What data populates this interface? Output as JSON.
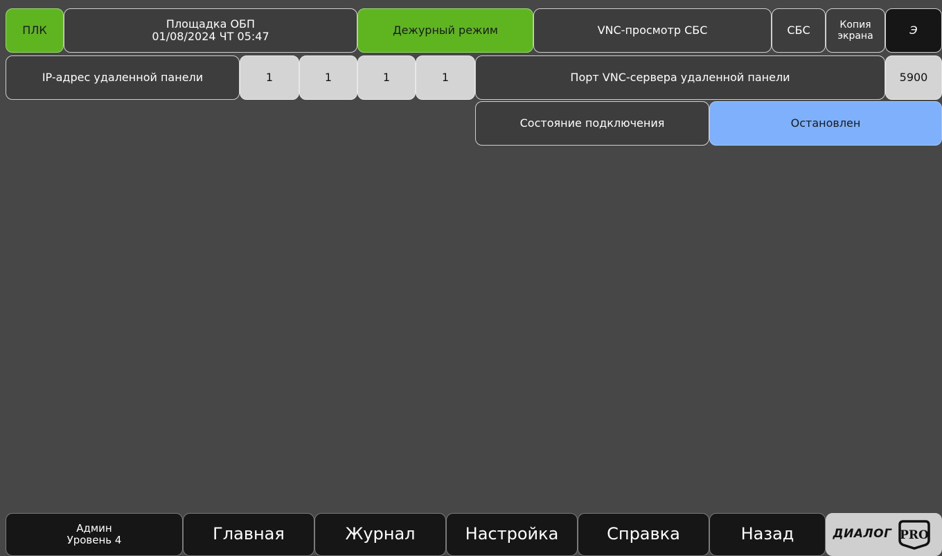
{
  "header": {
    "plc_label": "ПЛК",
    "site_name": "Площадка ОБП",
    "datetime": "01/08/2024 ЧТ 05:47",
    "mode_label": "Дежурный режим",
    "screen_title": "VNC-просмотр СБС",
    "sbs_label": "СБС",
    "screen_copy_line1": "Копия",
    "screen_copy_line2": "экрана",
    "e_label": "Э"
  },
  "ip_row": {
    "label": "IP-адрес удаленной панели",
    "octets": [
      "1",
      "1",
      "1",
      "1"
    ],
    "port_label": "Порт VNC-сервера удаленной панели",
    "port_value": "5900"
  },
  "status_row": {
    "label": "Состояние подключения",
    "value": "Остановлен"
  },
  "footer": {
    "user_name": "Админ",
    "user_level": "Уровень 4",
    "nav": [
      "Главная",
      "Журнал",
      "Настройка",
      "Справка",
      "Назад"
    ],
    "logo_text": "ДИАЛОГ",
    "logo_badge": "PRO"
  },
  "colors": {
    "background": "#474747",
    "active_green": "#5fb51f",
    "status_blue": "#7fb0fb",
    "input_gray": "#d4d4d4"
  }
}
